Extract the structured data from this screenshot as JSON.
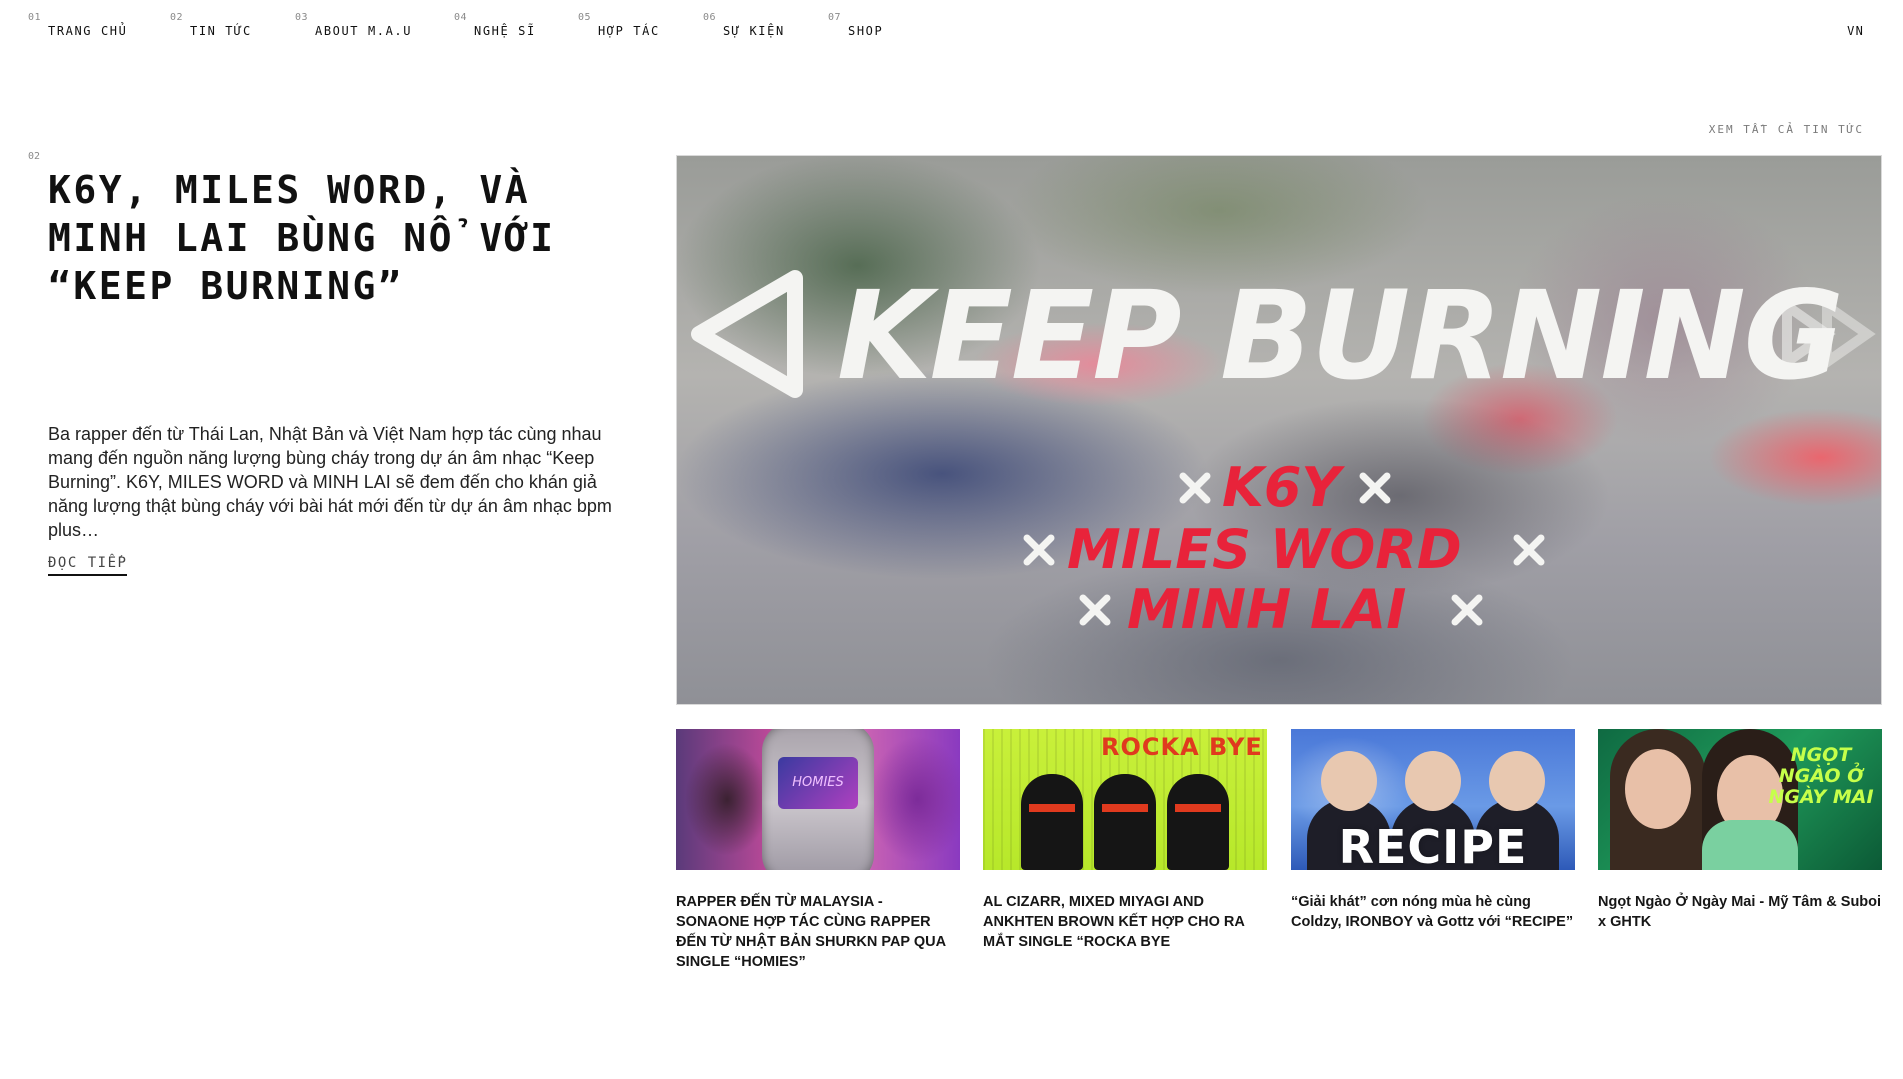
{
  "nav": {
    "items": [
      {
        "num": "01",
        "label": "TRANG CHỦ"
      },
      {
        "num": "02",
        "label": "TIN TỨC"
      },
      {
        "num": "03",
        "label": "ABOUT M.A.U"
      },
      {
        "num": "04",
        "label": "NGHỆ SĨ"
      },
      {
        "num": "05",
        "label": "HỢP TÁC"
      },
      {
        "num": "06",
        "label": "SỰ KIỆN"
      },
      {
        "num": "07",
        "label": "SHOP"
      }
    ],
    "language": "VN"
  },
  "news": {
    "see_all": "XEM TẤT CẢ TIN TỨC",
    "featured": {
      "num": "02",
      "title": "K6Y, MILES WORD, VÀ MINH LAI BÙNG NỔ VỚI “KEEP BURNING”",
      "excerpt": "Ba rapper đến từ Thái Lan, Nhật Bản và Việt Nam hợp tác cùng nhau mang đến nguồn năng lượng bùng cháy trong dự án âm nhạc “Keep Burning”. K6Y, MILES WORD và MINH LAI sẽ đem đến cho khán giả năng lượng thật bùng cháy với bài hát mới đến từ dự án âm nhạc bpm plus…",
      "read_more": "ĐỌC TIẾP",
      "image": {
        "title": "KEEP BURNING",
        "artists": [
          "K6Y",
          "MILES WORD",
          "MINH LAI"
        ],
        "colors": {
          "artist_red": "#e8233a",
          "title_white": "#f4f4f2"
        }
      }
    },
    "cards": [
      {
        "title": "RAPPER ĐẾN TỪ MALAYSIA - SONAONE HỢP TÁC CÙNG RAPPER ĐẾN TỪ NHẬT BẢN SHURKN PAP QUA SINGLE “HOMIES”",
        "thumb_text": "HOMIES"
      },
      {
        "title": "AL CIZARR, MIXED MIYAGI AND ANKHTEN BROWN KẾT HỢP CHO RA MẮT SINGLE “ROCKA BYE",
        "thumb_text": "ROCKA BYE"
      },
      {
        "title": "“Giải khát” cơn nóng mùa hè cùng Coldzy, IRONBOY và Gottz với “RECIPE”",
        "thumb_text": "RECIPE"
      },
      {
        "title": "Ngọt Ngào Ở Ngày Mai - Mỹ Tâm & Suboi x GHTK",
        "thumb_text": "NGỌT NGÀO Ở NGÀY MAI"
      }
    ]
  }
}
